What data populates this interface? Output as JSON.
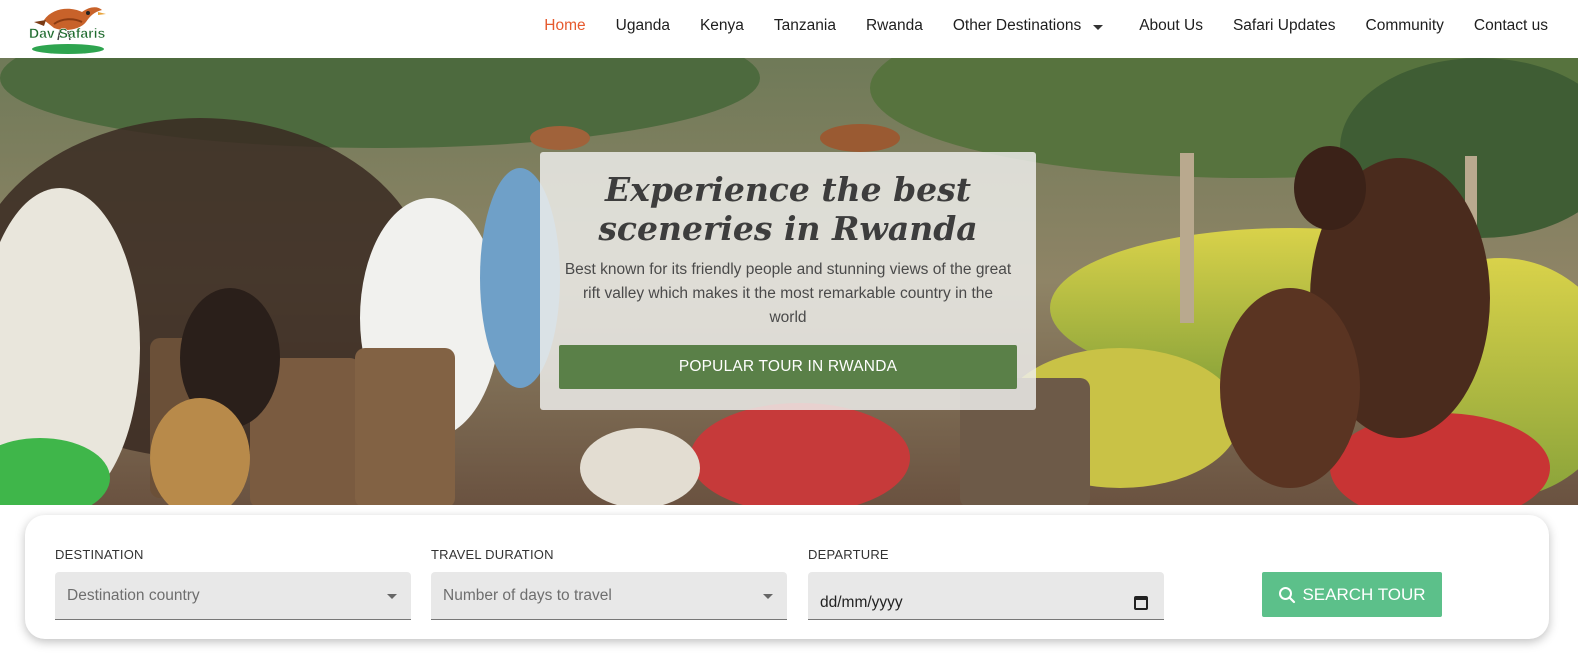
{
  "brand": {
    "logo_text": "DavSafaris"
  },
  "nav": {
    "items": [
      {
        "label": "Home",
        "active": true
      },
      {
        "label": "Uganda"
      },
      {
        "label": "Kenya"
      },
      {
        "label": "Tanzania"
      },
      {
        "label": "Rwanda"
      },
      {
        "label": "Other Destinations",
        "has_dropdown": true
      },
      {
        "label": "About Us"
      },
      {
        "label": "Safari Updates"
      },
      {
        "label": "Community"
      },
      {
        "label": "Contact us"
      }
    ]
  },
  "hero": {
    "title": "Experience the best sceneries in Rwanda",
    "description": "Best known for its friendly people and stunning views of the great rift valley which makes it the most remarkable country in the world",
    "button_label": "POPULAR TOUR IN RWANDA",
    "image_subject": "Rwandan traditional dancers and drummers"
  },
  "search": {
    "destination": {
      "label": "DESTINATION",
      "placeholder": "Destination country"
    },
    "duration": {
      "label": "TRAVEL DURATION",
      "placeholder": "Number of days to travel"
    },
    "departure": {
      "label": "DEPARTURE",
      "value": "dd/mm/yyyy"
    },
    "button_label": "SEARCH TOUR"
  },
  "colors": {
    "nav_active": "#e65a2e",
    "hero_button": "#5a8048",
    "search_button": "#5cc08a"
  }
}
